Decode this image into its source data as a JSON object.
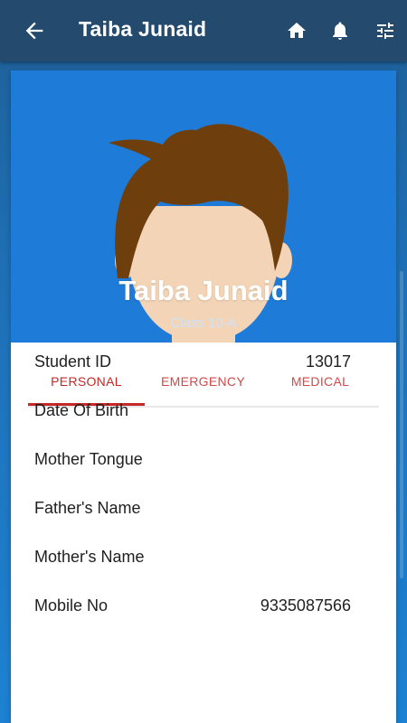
{
  "appbar": {
    "title": "Taiba Junaid",
    "icons": [
      "back-arrow-icon",
      "home-icon",
      "bell-icon",
      "tune-icon"
    ]
  },
  "profile": {
    "name": "Taiba Junaid",
    "class_label": "Class 10-A"
  },
  "tabs": [
    {
      "label": "PERSONAL",
      "active": true
    },
    {
      "label": "EMERGENCY",
      "active": false
    },
    {
      "label": "MEDICAL",
      "active": false
    }
  ],
  "details": [
    {
      "label": "Student ID",
      "value": "13017"
    },
    {
      "label": "Date Of Birth",
      "value": ""
    },
    {
      "label": "Mother Tongue",
      "value": ""
    },
    {
      "label": "Father's Name",
      "value": ""
    },
    {
      "label": "Mother's Name",
      "value": ""
    },
    {
      "label": "Mobile No",
      "value": "9335087566"
    }
  ],
  "colors": {
    "appbar": "#244a6e",
    "hero": "#1e7bd8",
    "accent": "#c62828",
    "tab_inactive": "#d04a4a"
  }
}
